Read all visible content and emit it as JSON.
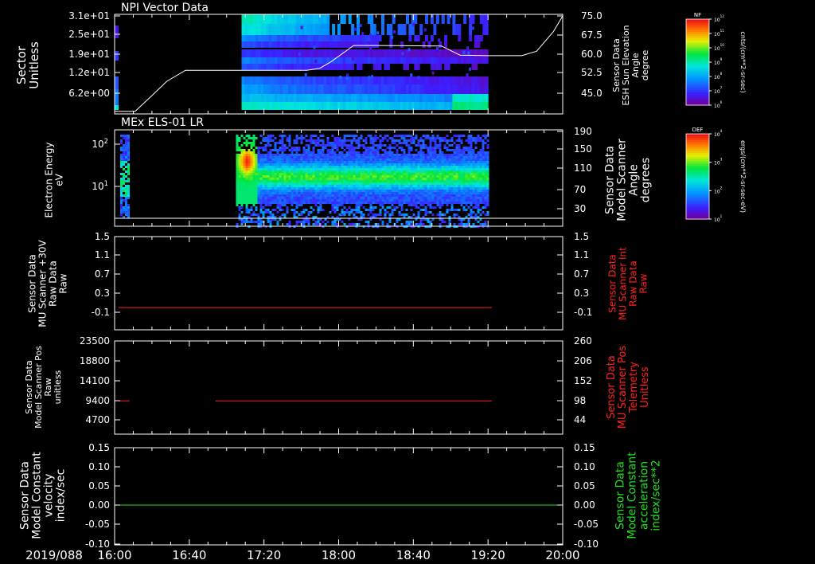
{
  "date_label": "2019/088",
  "colors": {
    "background": "#000000",
    "axis": "#ffffff",
    "red_series": "#ff2020",
    "green_series": "#20e020"
  },
  "chart_data": [
    {
      "id": "panel1",
      "type": "heatmap",
      "title": "NPI Vector Data",
      "ylabel_left": [
        "Sector",
        "Unitless"
      ],
      "ylabel_right": [
        "Sensor Data",
        "ESH Sun Elevation",
        "Angle",
        "degree"
      ],
      "yticks_left": [
        "3.1e+01",
        "2.5e+01",
        "1.9e+01",
        "1.2e+01",
        "6.2e+00"
      ],
      "yticks_right": [
        "75.0",
        "67.5",
        "60.0",
        "52.5",
        "45.0"
      ],
      "ylim_right": [
        37.5,
        75.0
      ],
      "colorbar": {
        "label": "NF",
        "units": "cnts/(cm**2-sr-sec)",
        "ticks": [
          "10^12",
          "10^11",
          "10^10",
          "10^9",
          "10^8",
          "10^7",
          "10^6"
        ]
      },
      "heatmap_time_range": [
        "17:08",
        "19:20"
      ],
      "overlay_line": {
        "name": "ESH Sun Elevation",
        "t": [
          "16:00",
          "16:11",
          "16:20",
          "16:28",
          "16:38",
          "16:46",
          "17:43",
          "17:50",
          "17:56",
          "18:08",
          "18:20",
          "18:55",
          "19:05",
          "19:20",
          "19:38",
          "19:46",
          "19:55",
          "20:00"
        ],
        "y": [
          38.5,
          38.5,
          44.5,
          50.0,
          54.2,
          54.2,
          54.2,
          55.0,
          57.5,
          63.7,
          63.7,
          63.5,
          60.0,
          59.8,
          59.8,
          61.5,
          69.0,
          75.0
        ]
      }
    },
    {
      "id": "panel2",
      "type": "heatmap",
      "title": "MEx ELS-01 LR",
      "ylabel_left": [
        "Electron Energy",
        "eV"
      ],
      "ylabel_right": [
        "Sensor Data",
        "Model Scanner",
        "Angle",
        "degrees"
      ],
      "yticks_left": [
        "10^2",
        "10^1"
      ],
      "yticks_right": [
        "190",
        "150",
        "110",
        "70",
        "30"
      ],
      "colorbar": {
        "label": "DEF",
        "units": "ergs/(cm**2-sr-sec-eV)",
        "ticks": [
          "10^4",
          "10^3",
          "10^2",
          "10^1"
        ]
      },
      "heatmap_time_ranges": [
        [
          "16:03",
          "16:07"
        ],
        [
          "17:05",
          "19:20"
        ]
      ],
      "overlay_line": {
        "name": "Model Scanner Angle",
        "t": [
          "16:00",
          "20:00"
        ],
        "y": [
          10,
          10
        ]
      }
    },
    {
      "id": "panel3",
      "type": "line",
      "ylabel_left": [
        "Sensor Data",
        "MU Scanner +30V",
        "Raw Data",
        "Raw"
      ],
      "ylabel_right": [
        "Sensor Data",
        "MU Scanner Int",
        "Raw Data",
        "Raw"
      ],
      "yticks_left": [
        "1.5",
        "1.1",
        "0.7",
        "0.3",
        "-0.1"
      ],
      "yticks_right": [
        "1.5",
        "1.1",
        "0.7",
        "0.3",
        "-0.1"
      ],
      "ylim": [
        -0.35,
        1.5
      ],
      "series": [
        {
          "t": [
            "16:02",
            "19:22"
          ],
          "y": [
            0.0,
            0.0
          ],
          "color": "red"
        }
      ]
    },
    {
      "id": "panel4",
      "type": "line",
      "ylabel_left": [
        "Sensor Data",
        "Model Scanner Pos",
        "Raw",
        "unitless"
      ],
      "ylabel_right": [
        "Sensor Data",
        "MU Scanner Pos",
        "Telemetry",
        "Unitless"
      ],
      "yticks_left": [
        "23500",
        "18800",
        "14100",
        "9400",
        "4700"
      ],
      "yticks_right": [
        "260",
        "206",
        "152",
        "98",
        "44"
      ],
      "ylim": [
        0,
        23500
      ],
      "series": [
        {
          "t": [
            "16:02",
            "16:08"
          ],
          "y": [
            8400,
            8400
          ],
          "color": "red"
        },
        {
          "t": [
            "16:54",
            "19:22"
          ],
          "y": [
            8400,
            8400
          ],
          "color": "red"
        }
      ]
    },
    {
      "id": "panel5",
      "type": "line",
      "ylabel_left": [
        "Sensor Data",
        "Model Constant",
        "velocity",
        "index/sec"
      ],
      "ylabel_right": [
        "Sensor Data",
        "Model Constant",
        "acceleration",
        "index/sec**2"
      ],
      "yticks_left": [
        "0.15",
        "0.10",
        "0.05",
        "0.00",
        "-0.05",
        "-0.10"
      ],
      "yticks_right": [
        "0.15",
        "0.10",
        "0.05",
        "0.00",
        "-0.05",
        "-0.10"
      ],
      "ylim": [
        -0.1,
        0.15
      ],
      "series": [
        {
          "t": [
            "16:00",
            "20:00"
          ],
          "y": [
            0.0,
            0.0
          ],
          "color": "green"
        }
      ]
    }
  ],
  "x_axis": {
    "range": [
      "16:00",
      "20:00"
    ],
    "ticks": [
      "16:00",
      "16:40",
      "17:20",
      "18:00",
      "18:40",
      "19:20",
      "20:00"
    ]
  }
}
